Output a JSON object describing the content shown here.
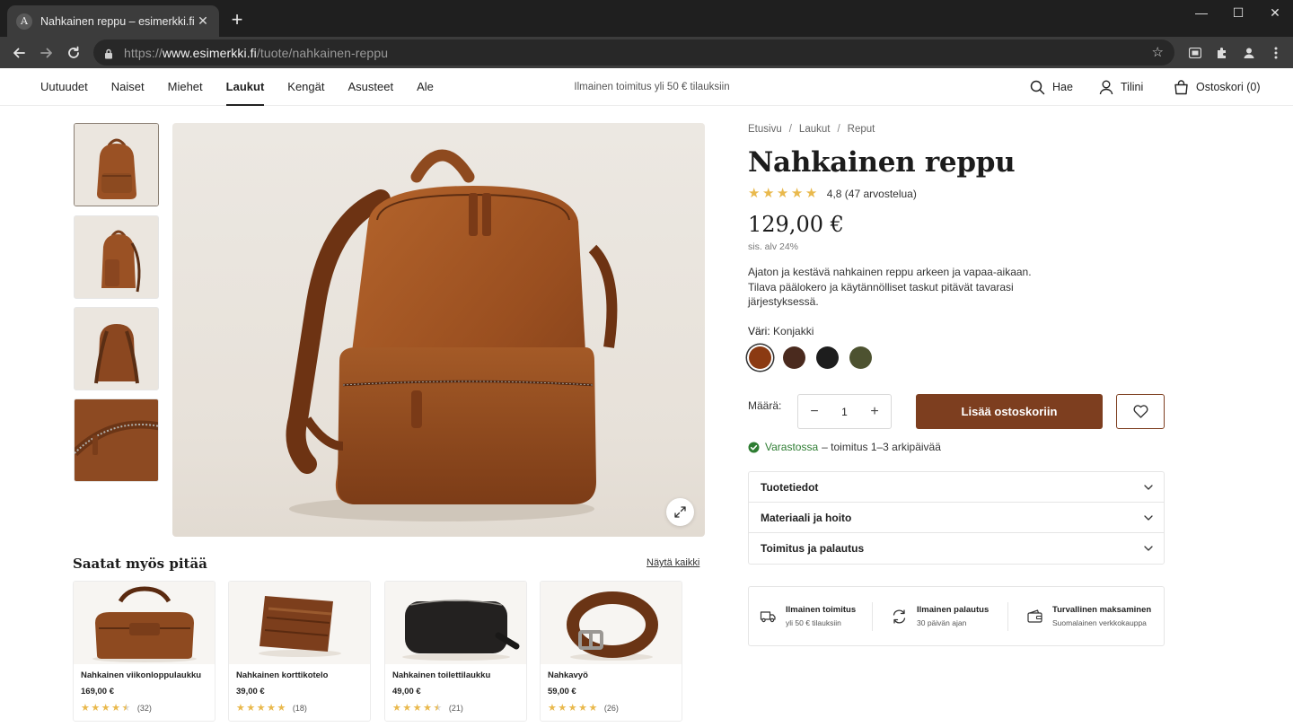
{
  "browser": {
    "tab_title": "Nahkainen reppu – esimerkki.fi",
    "tab_favicon": "A",
    "url_scheme": "https://",
    "url_host": "www.esimerkki.fi",
    "url_path": "/tuote/nahkainen-reppu"
  },
  "header": {
    "nav": [
      "Uutuudet",
      "Naiset",
      "Miehet",
      "Laukut",
      "Kengät",
      "Asusteet",
      "Ale"
    ],
    "active_nav": "Laukut",
    "promo": "Ilmainen toimitus yli 50 € tilauksiin",
    "search_label": "Hae",
    "account_label": "Tilini",
    "cart_label": "Ostoskori (0)"
  },
  "breadcrumb": [
    "Etusivu",
    "Laukut",
    "Reput"
  ],
  "breadcrumb_sep": "/",
  "product": {
    "title": "Nahkainen reppu",
    "rating_value": "4,8",
    "rating_count": "(47 arvostelua)",
    "stars": 5,
    "price": "129,00 €",
    "vat": "sis. alv 24%",
    "description": "Ajaton ja kestävä nahkainen reppu arkeen ja vapaa-aikaan. Tilava päälokero ja käytännölliset taskut pitävät tavarasi järjestyksessä.",
    "color_label": "Väri:",
    "color_value": "Konjakki",
    "swatches": [
      {
        "name": "Konjakki",
        "hex": "#8b3a12",
        "selected": true
      },
      {
        "name": "Tummanruskea",
        "hex": "#4a2a1e",
        "selected": false
      },
      {
        "name": "Musta",
        "hex": "#1d1d1d",
        "selected": false
      },
      {
        "name": "Oliivi",
        "hex": "#4d5230",
        "selected": false
      }
    ],
    "qty_label": "Määrä:",
    "qty_value": "1",
    "qty_minus": "−",
    "qty_plus": "+",
    "add_to_cart": "Lisää ostoskoriin",
    "stock_status": "Varastossa",
    "stock_detail": "– toimitus 1–3 arkipäivää"
  },
  "accordion": [
    "Tuotetiedot",
    "Materiaali ja hoito",
    "Toimitus ja palautus"
  ],
  "usps": [
    {
      "title": "Ilmainen toimitus",
      "sub": "yli 50 € tilauksiin",
      "icon": "truck-icon"
    },
    {
      "title": "Ilmainen palautus",
      "sub": "30 päivän ajan",
      "icon": "return-icon"
    },
    {
      "title": "Turvallinen maksaminen",
      "sub": "Suomalainen verkkokauppa",
      "icon": "wallet-icon"
    }
  ],
  "recommendations": {
    "title": "Saatat myös pitää",
    "view_all": "Näytä kaikki",
    "items": [
      {
        "name": "Nahkainen viikonloppulaukku",
        "price": "169,00 €",
        "stars": 4.5,
        "count": "(32)"
      },
      {
        "name": "Nahkainen korttikotelo",
        "price": "39,00 €",
        "stars": 5,
        "count": "(18)"
      },
      {
        "name": "Nahkainen toilettilaukku",
        "price": "49,00 €",
        "stars": 4.5,
        "count": "(21)"
      },
      {
        "name": "Nahkavyö",
        "price": "59,00 €",
        "stars": 5,
        "count": "(26)"
      }
    ]
  },
  "colors": {
    "accent": "#7d3e1f",
    "star": "#e9b94d",
    "in_stock": "#2e7d32"
  }
}
